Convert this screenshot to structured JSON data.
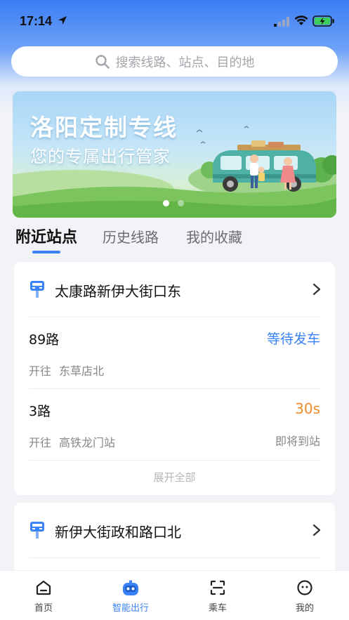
{
  "status_bar": {
    "time": "17:14"
  },
  "search": {
    "placeholder": "搜索线路、站点、目的地"
  },
  "banner": {
    "title": "洛阳定制专线",
    "subtitle": "您的专属出行管家",
    "page_count": 2,
    "active_page": 1
  },
  "tabs": [
    {
      "label": "附近站点",
      "active": true
    },
    {
      "label": "历史线路",
      "active": false
    },
    {
      "label": "我的收藏",
      "active": false
    }
  ],
  "stops": [
    {
      "name": "太康路新伊大街口东",
      "routes": [
        {
          "name": "89路",
          "status": "等待发车",
          "direction_label": "开往",
          "destination": "东草店北",
          "arrival": ""
        },
        {
          "name": "3路",
          "status": "30s",
          "direction_label": "开往",
          "destination": "高铁龙门站",
          "arrival": "即将到站"
        }
      ],
      "expand_label": "展开全部"
    },
    {
      "name": "新伊大街政和路口北"
    }
  ],
  "bottom_nav": [
    {
      "label": "首页",
      "icon": "home-icon",
      "active": false
    },
    {
      "label": "智能出行",
      "icon": "robot-icon",
      "active": true
    },
    {
      "label": "乘车",
      "icon": "scan-icon",
      "active": false
    },
    {
      "label": "我的",
      "icon": "profile-icon",
      "active": false
    }
  ],
  "colors": {
    "accent": "#3a82f7",
    "orange": "#f08a2a"
  }
}
